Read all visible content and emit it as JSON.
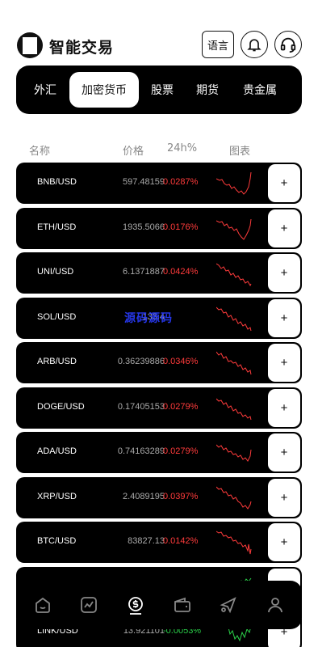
{
  "app": {
    "title": "智能交易",
    "lang_label": "语言"
  },
  "tabs": [
    {
      "label": "外汇",
      "active": false
    },
    {
      "label": "加密货币",
      "active": true
    },
    {
      "label": "股票",
      "active": false
    },
    {
      "label": "期货",
      "active": false
    },
    {
      "label": "贵金属",
      "active": false
    }
  ],
  "columns": {
    "name": "名称",
    "price": "价格",
    "change": "24h%",
    "chart": "图表"
  },
  "rows": [
    {
      "symbol": "BNB/USD",
      "price": "597.48159",
      "change": "0.0287%",
      "trend": "down",
      "add": "+"
    },
    {
      "symbol": "ETH/USD",
      "price": "1935.5066",
      "change": "0.0176%",
      "trend": "down",
      "add": "+"
    },
    {
      "symbol": "UNI/USD",
      "price": "6.1371887",
      "change": "0.0424%",
      "trend": "down",
      "add": "+"
    },
    {
      "symbol": "SOL/USD",
      "price": "133.4",
      "change": "",
      "trend": "down",
      "add": "+"
    },
    {
      "symbol": "ARB/USD",
      "price": "0.36239886",
      "change": "0.0346%",
      "trend": "down",
      "add": "+"
    },
    {
      "symbol": "DOGE/USD",
      "price": "0.17405153",
      "change": "0.0279%",
      "trend": "down",
      "add": "+"
    },
    {
      "symbol": "ADA/USD",
      "price": "0.74163289",
      "change": "0.0279%",
      "trend": "down",
      "add": "+"
    },
    {
      "symbol": "XRP/USD",
      "price": "2.4089195",
      "change": "0.0397%",
      "trend": "down",
      "add": "+"
    },
    {
      "symbol": "BTC/USD",
      "price": "83827.13",
      "change": "0.0142%",
      "trend": "down",
      "add": "+"
    },
    {
      "symbol": "",
      "price": "",
      "change": "",
      "trend": "up",
      "add": "+"
    },
    {
      "symbol": "LINK/USD",
      "price": "13.921101",
      "change": "-0.0053%",
      "trend": "up",
      "add": "+"
    }
  ],
  "watermark": "源码源码",
  "nav": [
    {
      "icon": "home-icon"
    },
    {
      "icon": "market-chart-icon"
    },
    {
      "icon": "trade-coin-icon"
    },
    {
      "icon": "wallet-icon"
    },
    {
      "icon": "share-icon"
    },
    {
      "icon": "user-icon"
    }
  ],
  "colors": {
    "down": "#ff3b3b",
    "up": "#2bd24a",
    "dark": "#000000"
  }
}
